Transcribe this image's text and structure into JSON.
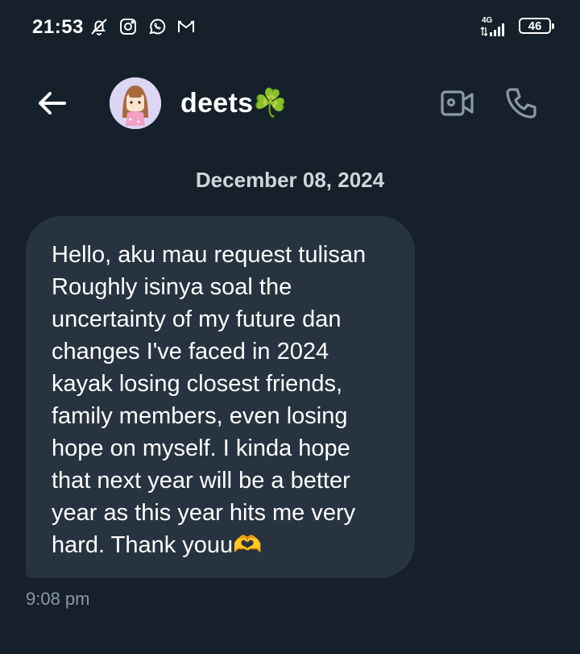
{
  "status_bar": {
    "time": "21:53",
    "network": "4G",
    "battery": "46",
    "icons": [
      "bell-off-icon",
      "instagram-icon",
      "whatsapp-icon",
      "gmail-icon"
    ]
  },
  "header": {
    "contact_name": "deets☘️",
    "back_icon": "arrow-left-icon",
    "video_icon": "video-camera-icon",
    "call_icon": "phone-icon"
  },
  "conversation": {
    "date": "December 08, 2024",
    "message": {
      "text": "Hello, aku mau request tulisan\nRoughly isinya soal the\nuncertainty of my future dan\nchanges I've faced in 2024\nkayak losing closest friends,\nfamily members, even losing\nhope on myself. I kinda hope\nthat next year will be a better\nyear as this year hits me very\nhard. Thank youu🫶",
      "time": "9:08 pm"
    }
  },
  "colors": {
    "background": "#15202b",
    "bubble": "#273340",
    "timestamp": "#8b98a5",
    "icon_muted": "#8b98a5"
  }
}
